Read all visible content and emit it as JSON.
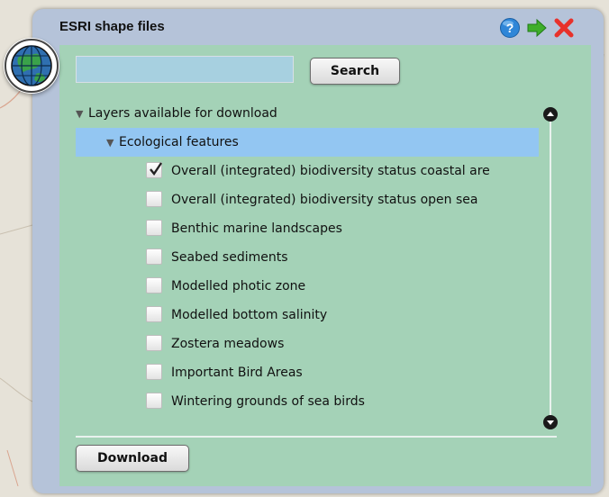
{
  "dialog": {
    "title": "ESRI shape files"
  },
  "header_icons": [
    "help-icon",
    "go-arrow-icon",
    "close-icon"
  ],
  "search": {
    "value": "",
    "button_label": "Search"
  },
  "tree": {
    "root_label": "Layers available for download",
    "group_label": "Ecological features",
    "items": [
      {
        "label": "Overall (integrated) biodiversity status coastal are",
        "checked": true
      },
      {
        "label": "Overall (integrated) biodiversity status open sea",
        "checked": false
      },
      {
        "label": "Benthic marine landscapes",
        "checked": false
      },
      {
        "label": "Seabed sediments",
        "checked": false
      },
      {
        "label": "Modelled photic zone",
        "checked": false
      },
      {
        "label": "Modelled bottom salinity",
        "checked": false
      },
      {
        "label": "Zostera meadows",
        "checked": false
      },
      {
        "label": "Important Bird Areas",
        "checked": false
      },
      {
        "label": "Wintering grounds of sea birds",
        "checked": false
      }
    ]
  },
  "footer": {
    "download_label": "Download"
  },
  "colors": {
    "panel": "#a4d2b7",
    "frame": "#b5c3d9",
    "group_highlight": "#93c6f2",
    "close_red": "#e8312b",
    "go_green": "#3fae2a",
    "help_blue": "#2f86d8"
  }
}
